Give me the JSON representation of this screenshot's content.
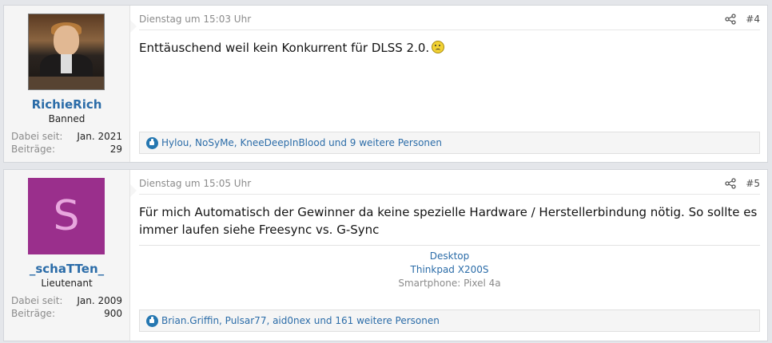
{
  "posts": [
    {
      "user": {
        "name": "RichieRich",
        "title": "Banned",
        "avatar": "photo-avatar",
        "stats": [
          {
            "key": "Dabei seit:",
            "value": "Jan. 2021"
          },
          {
            "key": "Beiträge:",
            "value": "29"
          }
        ]
      },
      "time": "Dienstag um 15:03 Uhr",
      "number": "#4",
      "share_icon": "share-icon",
      "body": "Enttäuschend weil kein Konkurrent für DLSS 2.0.",
      "emoji": "confused-smiley",
      "reactions": "Hylou, NoSyMe, KneeDeepInBlood und 9 weitere Personen"
    },
    {
      "user": {
        "name": "_schaTTen_",
        "title": "Lieutenant",
        "avatar_letter": "S",
        "stats": [
          {
            "key": "Dabei seit:",
            "value": "Jan. 2009"
          },
          {
            "key": "Beiträge:",
            "value": "900"
          }
        ]
      },
      "time": "Dienstag um 15:05 Uhr",
      "number": "#5",
      "share_icon": "share-icon",
      "body": "Für mich Automatisch der Gewinner da keine spezielle Hardware / Herstellerbindung nötig. So sollte es immer laufen siehe Freesync vs. G-Sync",
      "signature": {
        "link1": "Desktop",
        "link2": "Thinkpad X200S",
        "text": "Smartphone: Pixel 4a"
      },
      "reactions": "Brian.Griffin, Pulsar77, aid0nex und 161 weitere Personen"
    }
  ]
}
